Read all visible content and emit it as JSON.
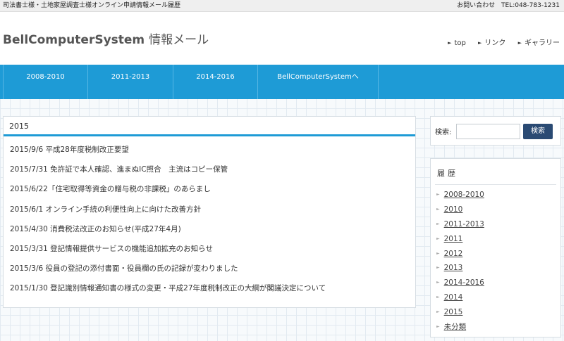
{
  "topbar": {
    "description": "司法書士様・土地家屋調査士様オンライン申請情報メール履歴",
    "contact_label": "お問い合わせ",
    "tel": "TEL:048-783-1231"
  },
  "header": {
    "site_name": "BellComputerSystem",
    "site_sub": "情報メール",
    "links": [
      "top",
      "リンク",
      "ギャラリー"
    ]
  },
  "nav": {
    "items": [
      "2008-2010",
      "2011-2013",
      "2014-2016",
      "BellComputerSystemへ"
    ]
  },
  "main": {
    "heading": "2015",
    "posts": [
      "2015/9/6 平成28年度税制改正要望",
      "2015/7/31 免許証で本人確認、進まぬIC照合　主流はコピー保管",
      "2015/6/22「住宅取得等資金の贈与税の非課税」のあらまし",
      "2015/6/1 オンライン手続の利便性向上に向けた改善方針",
      "2015/4/30 消費税法改正のお知らせ(平成27年4月)",
      "2015/3/31 登記情報提供サービスの機能追加拡充のお知らせ",
      "2015/3/6 役員の登記の添付書面・役員欄の氏の記録が変わりました",
      "2015/1/30 登記識別情報通知書の様式の変更・平成27年度税制改正の大綱が閣議決定について"
    ]
  },
  "sidebar": {
    "search_label": "検索:",
    "search_value": "",
    "search_button": "検索",
    "archive_title": "履歴",
    "archive_items": [
      "2008-2010",
      "2010",
      "2011-2013",
      "2011",
      "2012",
      "2013",
      "2014-2016",
      "2014",
      "2015",
      "未分類"
    ]
  },
  "colors": {
    "accent": "#1e9bd6",
    "button": "#2a4a73",
    "topbar": "#efefef"
  }
}
